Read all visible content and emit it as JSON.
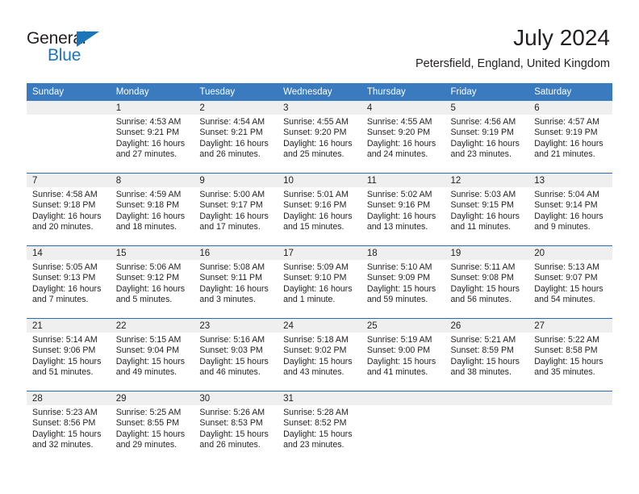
{
  "branding": {
    "logo_text_1": "General",
    "logo_text_2": "Blue",
    "logo_color_dark": "#231f20",
    "logo_color_blue": "#1b75bb",
    "triangle_icon": "triangle-icon"
  },
  "header": {
    "title": "July 2024",
    "subtitle": "Petersfield, England, United Kingdom",
    "accent_color": "#3a7bbf",
    "separator_color": "#2b6cb0",
    "daynum_band_color": "#efefef"
  },
  "weekday_headers": [
    "Sunday",
    "Monday",
    "Tuesday",
    "Wednesday",
    "Thursday",
    "Friday",
    "Saturday"
  ],
  "weeks": [
    {
      "days": [
        {
          "num": "",
          "empty": true,
          "sunrise": "",
          "sunset": "",
          "daylight_1": "",
          "daylight_2": ""
        },
        {
          "num": "1",
          "empty": false,
          "sunrise": "Sunrise: 4:53 AM",
          "sunset": "Sunset: 9:21 PM",
          "daylight_1": "Daylight: 16 hours",
          "daylight_2": "and 27 minutes."
        },
        {
          "num": "2",
          "empty": false,
          "sunrise": "Sunrise: 4:54 AM",
          "sunset": "Sunset: 9:21 PM",
          "daylight_1": "Daylight: 16 hours",
          "daylight_2": "and 26 minutes."
        },
        {
          "num": "3",
          "empty": false,
          "sunrise": "Sunrise: 4:55 AM",
          "sunset": "Sunset: 9:20 PM",
          "daylight_1": "Daylight: 16 hours",
          "daylight_2": "and 25 minutes."
        },
        {
          "num": "4",
          "empty": false,
          "sunrise": "Sunrise: 4:55 AM",
          "sunset": "Sunset: 9:20 PM",
          "daylight_1": "Daylight: 16 hours",
          "daylight_2": "and 24 minutes."
        },
        {
          "num": "5",
          "empty": false,
          "sunrise": "Sunrise: 4:56 AM",
          "sunset": "Sunset: 9:19 PM",
          "daylight_1": "Daylight: 16 hours",
          "daylight_2": "and 23 minutes."
        },
        {
          "num": "6",
          "empty": false,
          "sunrise": "Sunrise: 4:57 AM",
          "sunset": "Sunset: 9:19 PM",
          "daylight_1": "Daylight: 16 hours",
          "daylight_2": "and 21 minutes."
        }
      ]
    },
    {
      "days": [
        {
          "num": "7",
          "empty": false,
          "sunrise": "Sunrise: 4:58 AM",
          "sunset": "Sunset: 9:18 PM",
          "daylight_1": "Daylight: 16 hours",
          "daylight_2": "and 20 minutes."
        },
        {
          "num": "8",
          "empty": false,
          "sunrise": "Sunrise: 4:59 AM",
          "sunset": "Sunset: 9:18 PM",
          "daylight_1": "Daylight: 16 hours",
          "daylight_2": "and 18 minutes."
        },
        {
          "num": "9",
          "empty": false,
          "sunrise": "Sunrise: 5:00 AM",
          "sunset": "Sunset: 9:17 PM",
          "daylight_1": "Daylight: 16 hours",
          "daylight_2": "and 17 minutes."
        },
        {
          "num": "10",
          "empty": false,
          "sunrise": "Sunrise: 5:01 AM",
          "sunset": "Sunset: 9:16 PM",
          "daylight_1": "Daylight: 16 hours",
          "daylight_2": "and 15 minutes."
        },
        {
          "num": "11",
          "empty": false,
          "sunrise": "Sunrise: 5:02 AM",
          "sunset": "Sunset: 9:16 PM",
          "daylight_1": "Daylight: 16 hours",
          "daylight_2": "and 13 minutes."
        },
        {
          "num": "12",
          "empty": false,
          "sunrise": "Sunrise: 5:03 AM",
          "sunset": "Sunset: 9:15 PM",
          "daylight_1": "Daylight: 16 hours",
          "daylight_2": "and 11 minutes."
        },
        {
          "num": "13",
          "empty": false,
          "sunrise": "Sunrise: 5:04 AM",
          "sunset": "Sunset: 9:14 PM",
          "daylight_1": "Daylight: 16 hours",
          "daylight_2": "and 9 minutes."
        }
      ]
    },
    {
      "days": [
        {
          "num": "14",
          "empty": false,
          "sunrise": "Sunrise: 5:05 AM",
          "sunset": "Sunset: 9:13 PM",
          "daylight_1": "Daylight: 16 hours",
          "daylight_2": "and 7 minutes."
        },
        {
          "num": "15",
          "empty": false,
          "sunrise": "Sunrise: 5:06 AM",
          "sunset": "Sunset: 9:12 PM",
          "daylight_1": "Daylight: 16 hours",
          "daylight_2": "and 5 minutes."
        },
        {
          "num": "16",
          "empty": false,
          "sunrise": "Sunrise: 5:08 AM",
          "sunset": "Sunset: 9:11 PM",
          "daylight_1": "Daylight: 16 hours",
          "daylight_2": "and 3 minutes."
        },
        {
          "num": "17",
          "empty": false,
          "sunrise": "Sunrise: 5:09 AM",
          "sunset": "Sunset: 9:10 PM",
          "daylight_1": "Daylight: 16 hours",
          "daylight_2": "and 1 minute."
        },
        {
          "num": "18",
          "empty": false,
          "sunrise": "Sunrise: 5:10 AM",
          "sunset": "Sunset: 9:09 PM",
          "daylight_1": "Daylight: 15 hours",
          "daylight_2": "and 59 minutes."
        },
        {
          "num": "19",
          "empty": false,
          "sunrise": "Sunrise: 5:11 AM",
          "sunset": "Sunset: 9:08 PM",
          "daylight_1": "Daylight: 15 hours",
          "daylight_2": "and 56 minutes."
        },
        {
          "num": "20",
          "empty": false,
          "sunrise": "Sunrise: 5:13 AM",
          "sunset": "Sunset: 9:07 PM",
          "daylight_1": "Daylight: 15 hours",
          "daylight_2": "and 54 minutes."
        }
      ]
    },
    {
      "days": [
        {
          "num": "21",
          "empty": false,
          "sunrise": "Sunrise: 5:14 AM",
          "sunset": "Sunset: 9:06 PM",
          "daylight_1": "Daylight: 15 hours",
          "daylight_2": "and 51 minutes."
        },
        {
          "num": "22",
          "empty": false,
          "sunrise": "Sunrise: 5:15 AM",
          "sunset": "Sunset: 9:04 PM",
          "daylight_1": "Daylight: 15 hours",
          "daylight_2": "and 49 minutes."
        },
        {
          "num": "23",
          "empty": false,
          "sunrise": "Sunrise: 5:16 AM",
          "sunset": "Sunset: 9:03 PM",
          "daylight_1": "Daylight: 15 hours",
          "daylight_2": "and 46 minutes."
        },
        {
          "num": "24",
          "empty": false,
          "sunrise": "Sunrise: 5:18 AM",
          "sunset": "Sunset: 9:02 PM",
          "daylight_1": "Daylight: 15 hours",
          "daylight_2": "and 43 minutes."
        },
        {
          "num": "25",
          "empty": false,
          "sunrise": "Sunrise: 5:19 AM",
          "sunset": "Sunset: 9:00 PM",
          "daylight_1": "Daylight: 15 hours",
          "daylight_2": "and 41 minutes."
        },
        {
          "num": "26",
          "empty": false,
          "sunrise": "Sunrise: 5:21 AM",
          "sunset": "Sunset: 8:59 PM",
          "daylight_1": "Daylight: 15 hours",
          "daylight_2": "and 38 minutes."
        },
        {
          "num": "27",
          "empty": false,
          "sunrise": "Sunrise: 5:22 AM",
          "sunset": "Sunset: 8:58 PM",
          "daylight_1": "Daylight: 15 hours",
          "daylight_2": "and 35 minutes."
        }
      ]
    },
    {
      "days": [
        {
          "num": "28",
          "empty": false,
          "sunrise": "Sunrise: 5:23 AM",
          "sunset": "Sunset: 8:56 PM",
          "daylight_1": "Daylight: 15 hours",
          "daylight_2": "and 32 minutes."
        },
        {
          "num": "29",
          "empty": false,
          "sunrise": "Sunrise: 5:25 AM",
          "sunset": "Sunset: 8:55 PM",
          "daylight_1": "Daylight: 15 hours",
          "daylight_2": "and 29 minutes."
        },
        {
          "num": "30",
          "empty": false,
          "sunrise": "Sunrise: 5:26 AM",
          "sunset": "Sunset: 8:53 PM",
          "daylight_1": "Daylight: 15 hours",
          "daylight_2": "and 26 minutes."
        },
        {
          "num": "31",
          "empty": false,
          "sunrise": "Sunrise: 5:28 AM",
          "sunset": "Sunset: 8:52 PM",
          "daylight_1": "Daylight: 15 hours",
          "daylight_2": "and 23 minutes."
        },
        {
          "num": "",
          "empty": true,
          "sunrise": "",
          "sunset": "",
          "daylight_1": "",
          "daylight_2": ""
        },
        {
          "num": "",
          "empty": true,
          "sunrise": "",
          "sunset": "",
          "daylight_1": "",
          "daylight_2": ""
        },
        {
          "num": "",
          "empty": true,
          "sunrise": "",
          "sunset": "",
          "daylight_1": "",
          "daylight_2": ""
        }
      ]
    }
  ]
}
